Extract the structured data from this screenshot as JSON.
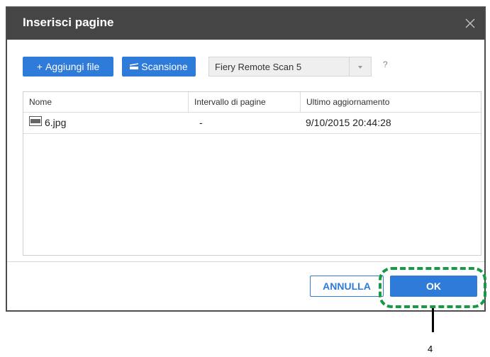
{
  "dialog": {
    "title": "Inserisci pagine",
    "close_icon": "close-icon"
  },
  "toolbar": {
    "add_file_label": "Aggiungi file",
    "add_icon": "plus-icon",
    "scan_label": "Scansione",
    "scan_icon": "scanner-icon",
    "scanner_selected": "Fiery Remote Scan 5",
    "help_label": "?"
  },
  "table": {
    "columns": [
      "Nome",
      "Intervallo di pagine",
      "Ultimo aggiornamento"
    ],
    "rows": [
      {
        "name": "6.jpg",
        "icon": "jpg-file-icon",
        "range": "-",
        "updated": "9/10/2015 20:44:28"
      }
    ]
  },
  "footer": {
    "cancel_label": "ANNULLA",
    "ok_label": "OK"
  },
  "callout": {
    "number": "4"
  },
  "colors": {
    "titlebar": "#454545",
    "accent": "#2e7bd9",
    "highlight": "#159a45"
  }
}
